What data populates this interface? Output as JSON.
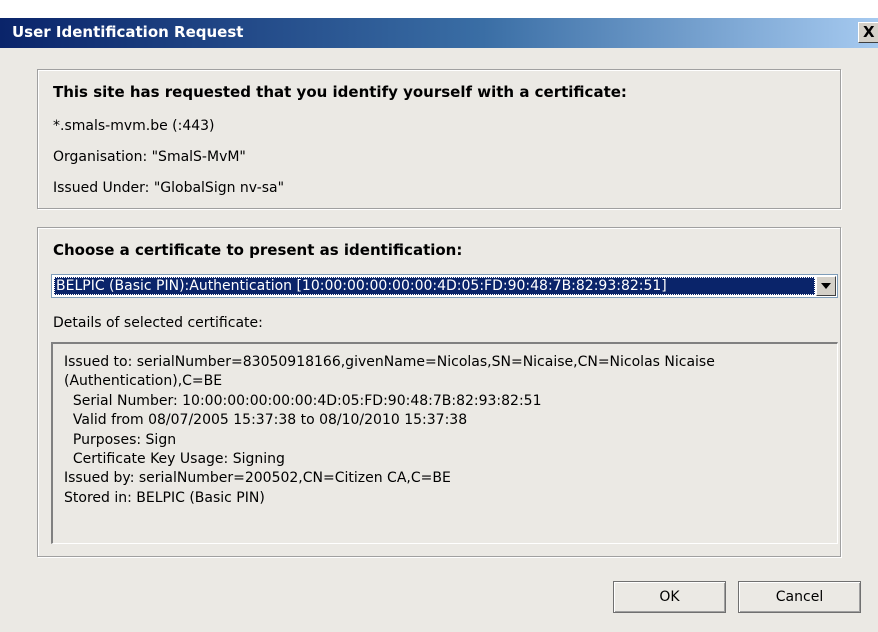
{
  "window": {
    "title": "User Identification Request",
    "close_glyph": "X"
  },
  "site_section": {
    "heading": "This site has requested that you identify yourself with a certificate:",
    "host": "*.smals-mvm.be (:443)",
    "organisation": "Organisation: \"SmalS-MvM\"",
    "issued_under": "Issued Under: \"GlobalSign nv-sa\""
  },
  "cert_section": {
    "heading": "Choose a certificate to present as identification:",
    "selected_certificate": "BELPIC (Basic PIN):Authentication [10:00:00:00:00:00:4D:05:FD:90:48:7B:82:93:82:51]",
    "details_label": "Details of selected certificate:",
    "details": [
      "Issued to: serialNumber=83050918166,givenName=Nicolas,SN=Nicaise,CN=Nicolas Nicaise",
      "(Authentication),C=BE",
      "  Serial Number: 10:00:00:00:00:00:4D:05:FD:90:48:7B:82:93:82:51",
      "  Valid from 08/07/2005 15:37:38 to 08/10/2010 15:37:38",
      "  Purposes: Sign",
      "  Certificate Key Usage: Signing",
      "Issued by: serialNumber=200502,CN=Citizen CA,C=BE",
      "Stored in: BELPIC (Basic PIN)"
    ]
  },
  "buttons": {
    "ok": "OK",
    "cancel": "Cancel"
  }
}
